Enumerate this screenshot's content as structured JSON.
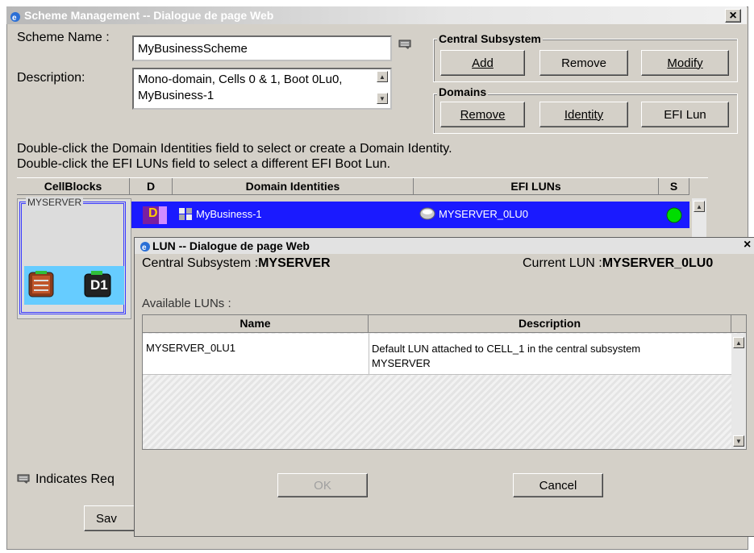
{
  "main_window": {
    "title": "Scheme Management -- Dialogue de page Web",
    "close_glyph": "×"
  },
  "form": {
    "scheme_name_label": "Scheme Name :",
    "scheme_name_value": "MyBusinessScheme",
    "description_label": "Description:",
    "description_value": "Mono-domain, Cells 0 & 1, Boot 0Lu0, MyBusiness-1"
  },
  "central_subsystem": {
    "title": "Central Subsystem",
    "add_label": "Add",
    "remove_label": "Remove",
    "modify_label": "Modify"
  },
  "domains": {
    "title": "Domains",
    "remove_label": "Remove",
    "identity_label": "Identity",
    "efi_lun_label": "EFI Lun"
  },
  "instructions": [
    "Double-click the Domain Identities field to select or create a Domain Identity.",
    "Double-click the EFI LUNs field to select a different EFI Boot Lun."
  ],
  "table": {
    "headers": [
      "CellBlocks",
      "D",
      "Domain Identities",
      "EFI LUNs",
      "S"
    ],
    "cellblock_name": "MYSERVER",
    "domain_badge": "D1",
    "row": {
      "d_icon_text": "D",
      "domain_identity": "MyBusiness-1",
      "efi_lun": "MYSERVER_0LU0",
      "status_color": "#00dd00"
    }
  },
  "footer": {
    "required_note": "Indicates Req",
    "save_label_partial": "Sav"
  },
  "lun_dialog": {
    "title": "LUN -- Dialogue de page Web",
    "close_glyph": "×",
    "central_subsystem_label": "Central Subsystem :",
    "central_subsystem_value": "MYSERVER",
    "current_lun_label": "Current LUN :",
    "current_lun_value": "MYSERVER_0LU0",
    "available_luns_label": "Available LUNs :",
    "columns": [
      "Name",
      "Description"
    ],
    "rows": [
      {
        "name": "MYSERVER_0LU1",
        "description_line1": "Default LUN attached to CELL_1 in the central subsystem",
        "description_line2": "MYSERVER"
      }
    ],
    "ok_label": "OK",
    "cancel_label": "Cancel"
  },
  "colors": {
    "selection_blue": "#1a1aff",
    "window_face": "#d4d0c8",
    "cellblock_border": "#3a3aff",
    "cellblock_fill": "#66ccff"
  }
}
